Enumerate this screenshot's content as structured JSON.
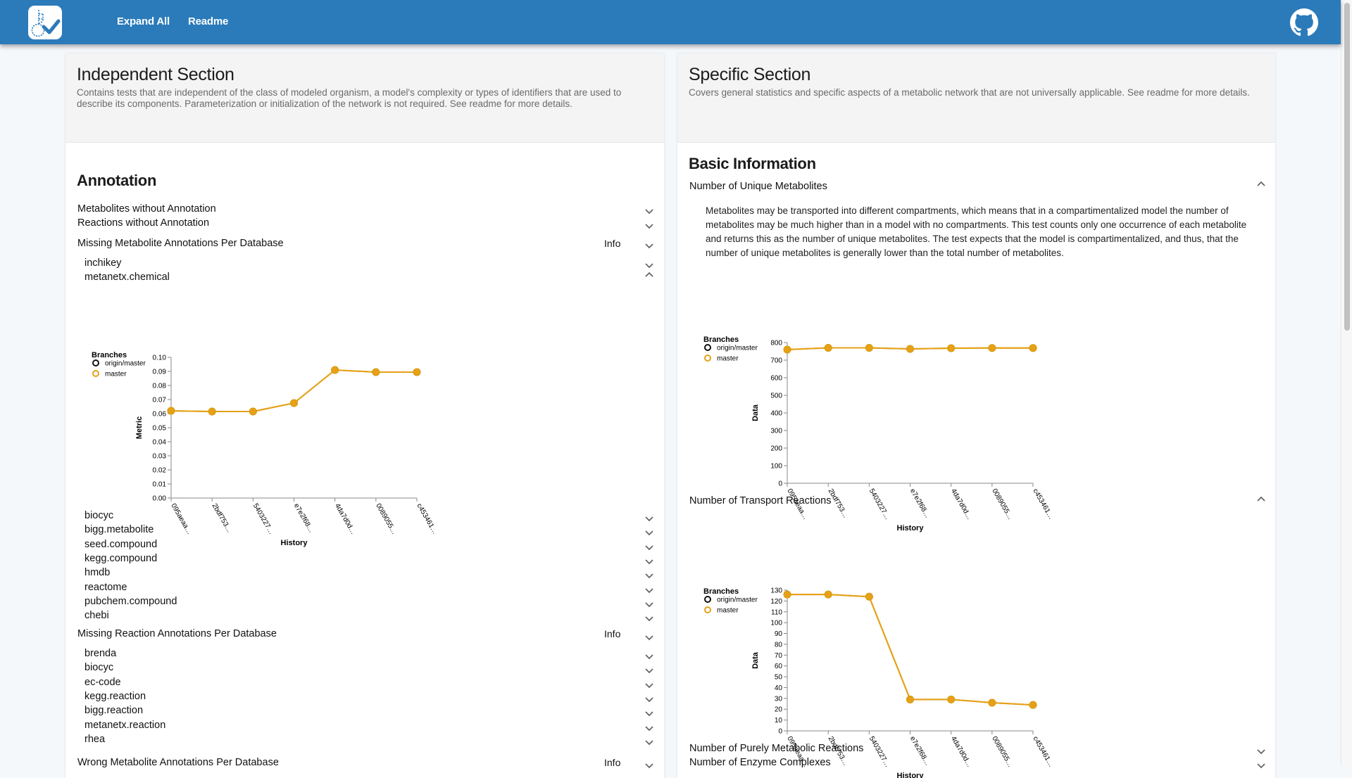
{
  "header": {
    "logo_icon": "memote-logo-icon",
    "nav": [
      "Expand All",
      "Readme"
    ],
    "github_icon": "github-icon",
    "brand_color": "#2b7bba"
  },
  "independent": {
    "title": "Independent Section",
    "description": "Contains tests that are independent of the class of modeled organism, a model's complexity or types of identifiers that are used to describe its components. Parameterization or initialization of the network is not required. See readme for more details.",
    "group_title": "Annotation",
    "tests": [
      {
        "label": "Metabolites without Annotation",
        "expanded": false
      },
      {
        "label": "Reactions without Annotation",
        "expanded": false
      },
      {
        "label": "Missing Metabolite Annotations Per Database",
        "info": "Info",
        "expanded": true,
        "subitems": [
          {
            "label": "inchikey",
            "expanded": false
          },
          {
            "label": "metanetx.chemical",
            "expanded": true
          },
          {
            "label": "biocyc",
            "expanded": false
          },
          {
            "label": "bigg.metabolite",
            "expanded": false
          },
          {
            "label": "seed.compound",
            "expanded": false
          },
          {
            "label": "kegg.compound",
            "expanded": false
          },
          {
            "label": "hmdb",
            "expanded": false
          },
          {
            "label": "reactome",
            "expanded": false
          },
          {
            "label": "pubchem.compound",
            "expanded": false
          },
          {
            "label": "chebi",
            "expanded": false
          }
        ]
      },
      {
        "label": "Missing Reaction Annotations Per Database",
        "info": "Info",
        "expanded": true,
        "subitems": [
          {
            "label": "brenda",
            "expanded": false
          },
          {
            "label": "biocyc",
            "expanded": false
          },
          {
            "label": "ec-code",
            "expanded": false
          },
          {
            "label": "kegg.reaction",
            "expanded": false
          },
          {
            "label": "bigg.reaction",
            "expanded": false
          },
          {
            "label": "metanetx.reaction",
            "expanded": false
          },
          {
            "label": "rhea",
            "expanded": false
          }
        ]
      },
      {
        "label": "Wrong Metabolite Annotations Per Database",
        "info": "Info",
        "expanded": false
      }
    ]
  },
  "specific": {
    "title": "Specific Section",
    "description": "Covers general statistics and specific aspects of a metabolic network that are not universally applicable. See readme for more details.",
    "group_title": "Basic Information",
    "tests": [
      {
        "label": "Number of Unique Metabolites",
        "expanded": true,
        "description": "Metabolites may be transported into different compartments, which means that in a compartimentalized model the number of metabolites may be much higher than in a model with no compartments. This test counts only one occurrence of each metabolite and returns this as the number of unique metabolites. The test expects that the model is compartimentalized, and thus, that the number of unique metabolites is generally lower than the total number of metabolites."
      },
      {
        "label": "Number of Transport Reactions",
        "expanded": true
      },
      {
        "label": "Number of Purely Metabolic Reactions",
        "expanded": false
      },
      {
        "label": "Number of Enzyme Complexes",
        "expanded": false
      }
    ]
  },
  "chart_data": [
    {
      "type": "line",
      "id": "metanetx-chemical",
      "title": "",
      "xlabel": "History",
      "ylabel": "Metric",
      "categories": [
        "095aeaa…",
        "2bdf753…",
        "5403227…",
        "e7e2f68…",
        "4da7d0d…",
        "0089055…",
        "c453461…"
      ],
      "ylim": [
        0,
        0.1
      ],
      "yticks": [
        "0.00",
        "0.01",
        "0.02",
        "0.03",
        "0.04",
        "0.05",
        "0.06",
        "0.07",
        "0.08",
        "0.09",
        "0.10"
      ],
      "legend": {
        "title": "Branches",
        "entries": [
          {
            "name": "origin/master",
            "color": "#111111"
          },
          {
            "name": "master",
            "color": "#e6a117"
          }
        ],
        "placement": "top-left"
      },
      "series": [
        {
          "name": "origin/master",
          "values": [
            0.062,
            0.0615,
            0.0615,
            0.0675,
            0.091,
            0.0895,
            0.0895
          ]
        },
        {
          "name": "master",
          "values": [
            0.062,
            0.0615,
            0.0615,
            0.0675,
            0.091,
            0.0895,
            0.0895
          ]
        }
      ]
    },
    {
      "type": "line",
      "id": "unique-metabolites",
      "title": "",
      "xlabel": "History",
      "ylabel": "Data",
      "categories": [
        "095aeaa…",
        "2bdf753…",
        "5403227…",
        "e7e2f68…",
        "4da7d0d…",
        "0089055…",
        "c453461…"
      ],
      "ylim": [
        0,
        800
      ],
      "yticks": [
        "0",
        "100",
        "200",
        "300",
        "400",
        "500",
        "600",
        "700",
        "800"
      ],
      "legend": {
        "title": "Branches",
        "entries": [
          {
            "name": "origin/master",
            "color": "#111111"
          },
          {
            "name": "master",
            "color": "#e6a117"
          }
        ],
        "placement": "top-left"
      },
      "series": [
        {
          "name": "origin/master",
          "values": [
            760,
            770,
            770,
            764,
            768,
            769,
            769
          ]
        },
        {
          "name": "master",
          "values": [
            760,
            770,
            770,
            764,
            768,
            769,
            769
          ]
        }
      ]
    },
    {
      "type": "line",
      "id": "transport-reactions",
      "title": "",
      "xlabel": "History",
      "ylabel": "Data",
      "categories": [
        "095aeaa…",
        "2bdf753…",
        "5403227…",
        "e7e2f68…",
        "4da7d0d…",
        "0089055…",
        "c453461…"
      ],
      "ylim": [
        0,
        130
      ],
      "yticks": [
        "0",
        "10",
        "20",
        "30",
        "40",
        "50",
        "60",
        "70",
        "80",
        "90",
        "100",
        "110",
        "120",
        "130"
      ],
      "legend": {
        "title": "Branches",
        "entries": [
          {
            "name": "origin/master",
            "color": "#111111"
          },
          {
            "name": "master",
            "color": "#e6a117"
          }
        ],
        "placement": "top-left"
      },
      "series": [
        {
          "name": "origin/master",
          "values": [
            126,
            126,
            124,
            29,
            29,
            26,
            24
          ]
        },
        {
          "name": "master",
          "values": [
            126,
            126,
            124,
            29,
            29,
            26,
            24
          ]
        }
      ]
    }
  ]
}
